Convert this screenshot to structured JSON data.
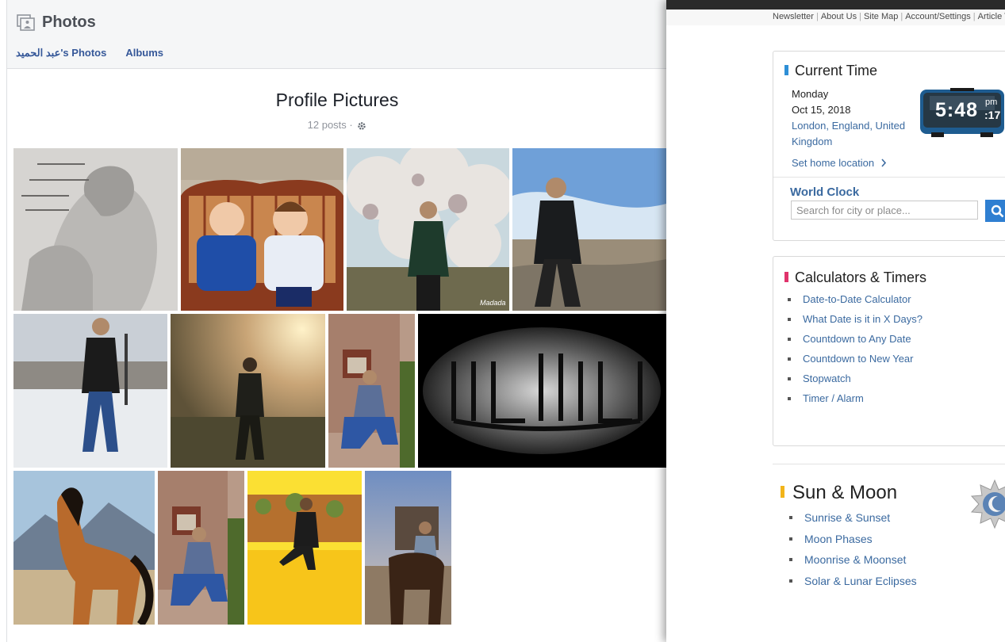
{
  "photos_app": {
    "title": "Photos",
    "tabs": [
      "عبد الحميد's Photos",
      "Albums"
    ],
    "album": {
      "title": "Profile Pictures",
      "meta": "12 posts ·"
    },
    "photos": [
      {
        "id": 1,
        "desc": "pencil-drawing",
        "caption": ""
      },
      {
        "id": 2,
        "desc": "two-children-on-sofa",
        "caption": ""
      },
      {
        "id": 3,
        "desc": "man-under-blossom-tree",
        "caption": "Madada"
      },
      {
        "id": 4,
        "desc": "man-on-hill",
        "caption": ""
      },
      {
        "id": 5,
        "desc": "man-on-snowy-roof",
        "caption": ""
      },
      {
        "id": 6,
        "desc": "man-at-sunset",
        "caption": ""
      },
      {
        "id": 7,
        "desc": "man-crouching-by-wall",
        "caption": ""
      },
      {
        "id": 8,
        "desc": "arabic-calligraphy",
        "caption": ""
      },
      {
        "id": 9,
        "desc": "horse",
        "caption": ""
      },
      {
        "id": 10,
        "desc": "man-crouching-by-wall-2",
        "caption": ""
      },
      {
        "id": 11,
        "desc": "man-on-yellow-wall",
        "caption": ""
      },
      {
        "id": 12,
        "desc": "man-on-horse",
        "caption": ""
      }
    ]
  },
  "timeanddate": {
    "top_links": [
      "Newsletter",
      "About Us",
      "Site Map",
      "Account/Settings",
      "Article T"
    ],
    "current_time": {
      "title": "Current Time",
      "day": "Monday",
      "date": "Oct 15, 2018",
      "location": "London, England, United Kingdom",
      "set_home": "Set home location",
      "clock": {
        "time": "5:48",
        "ampm": "pm",
        "seconds": ":17"
      }
    },
    "world_clock": {
      "title": "World Clock",
      "placeholder": "Search for city or place..."
    },
    "calculators": {
      "title": "Calculators & Timers",
      "items": [
        "Date-to-Date Calculator",
        "What Date is it in X Days?",
        "Countdown to Any Date",
        "Countdown to New Year",
        "Stopwatch",
        "Timer / Alarm"
      ]
    },
    "sun_moon": {
      "title": "Sun & Moon",
      "items": [
        "Sunrise & Sunset",
        "Moon Phases",
        "Moonrise & Moonset",
        "Solar & Lunar Eclipses"
      ]
    },
    "colors": {
      "link": "#3b6aa0",
      "accent_time": "#2e8fd6",
      "accent_calc": "#e0336b",
      "accent_sun": "#f2b41a",
      "search_button": "#2f7fd1"
    }
  }
}
